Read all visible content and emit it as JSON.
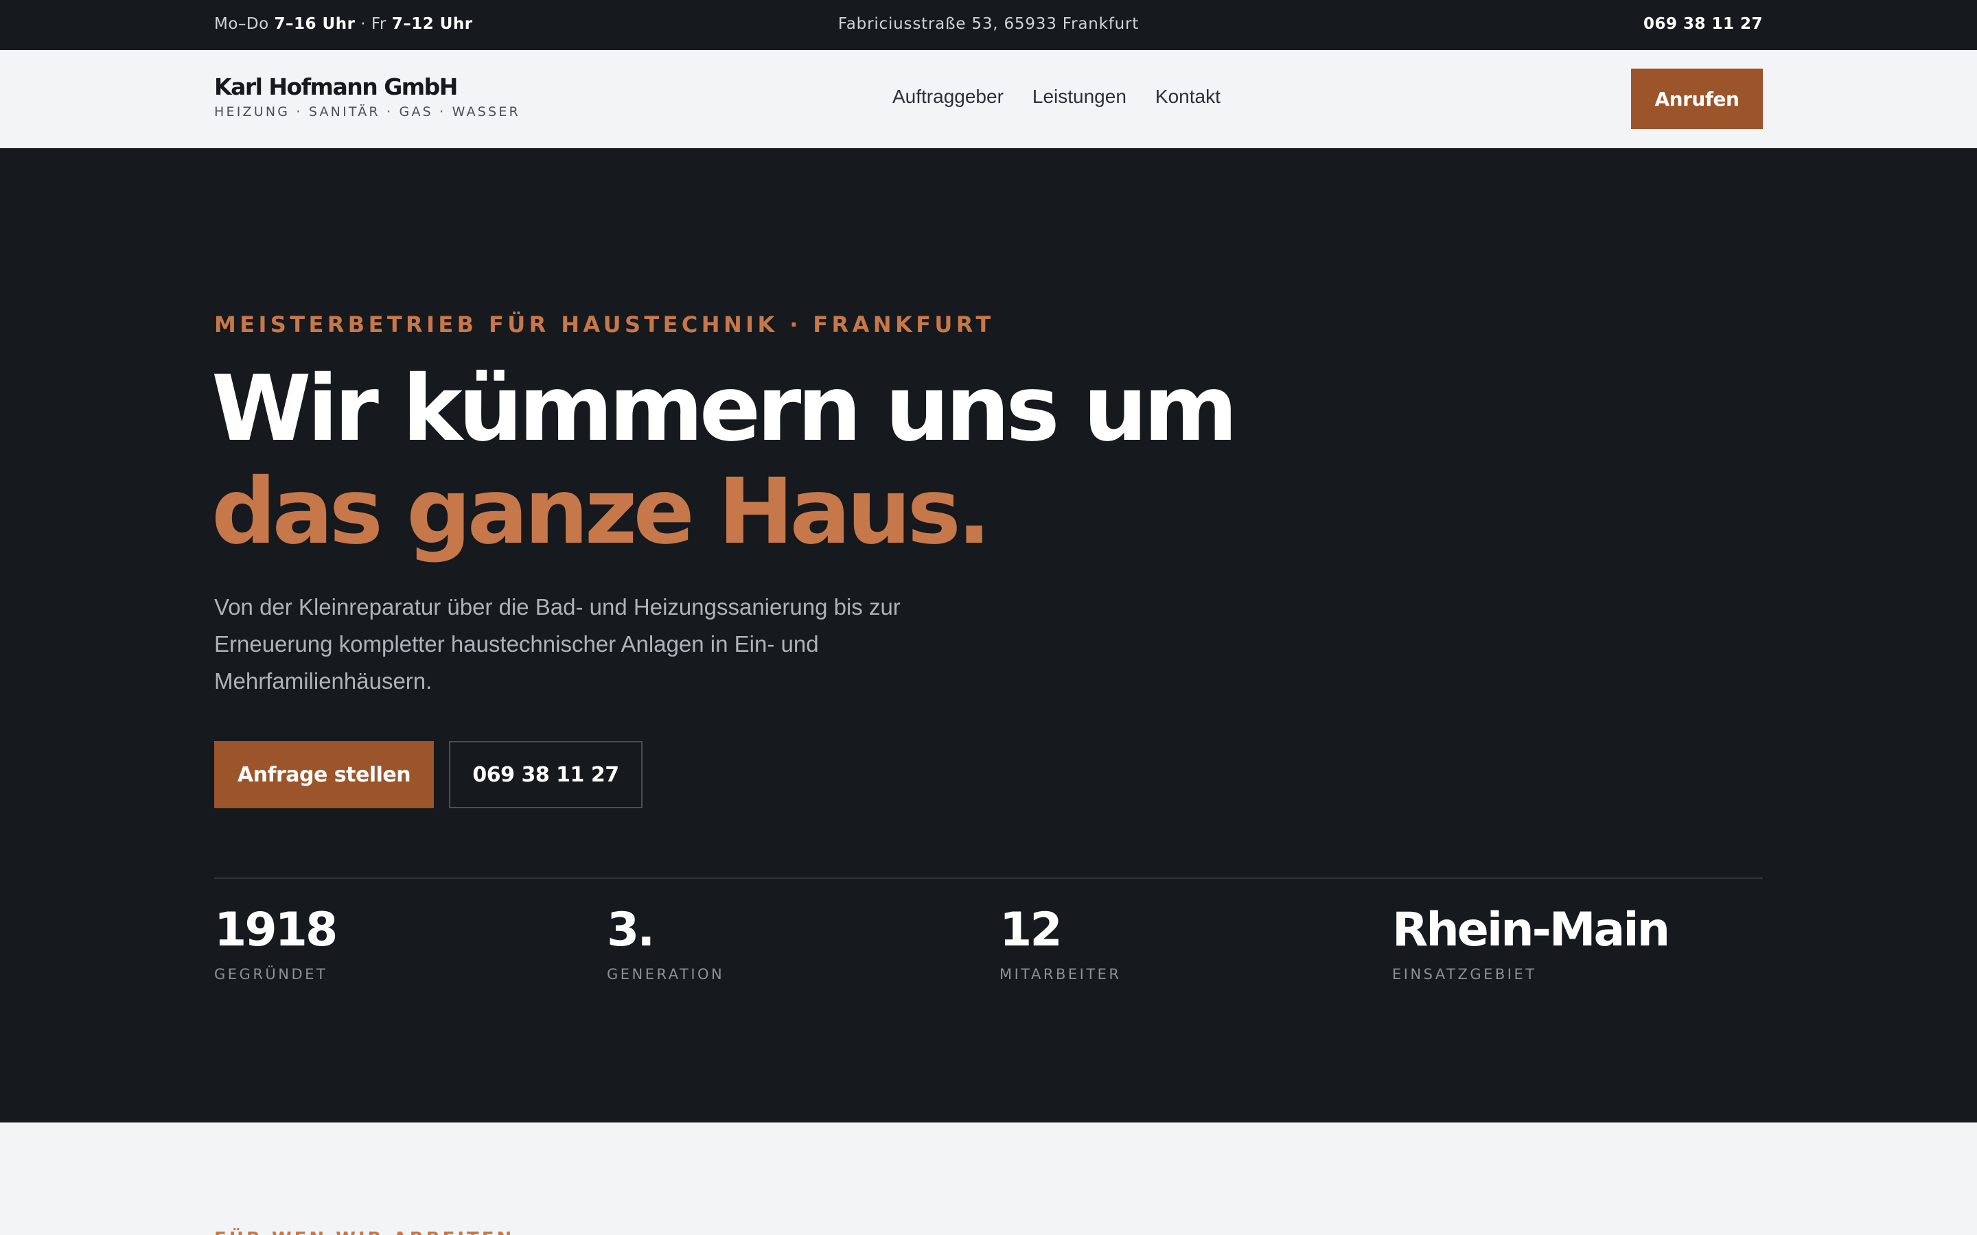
{
  "topbar": {
    "hours_prefix1": "Mo–Do ",
    "hours_value1": "7–16 Uhr",
    "hours_sep": " · Fr ",
    "hours_value2": "7–12 Uhr",
    "address": "Fabriciusstraße 53, 65933 Frankfurt",
    "phone": "069 38 11 27"
  },
  "header": {
    "brand_name": "Karl Hofmann GmbH",
    "brand_tagline": "HEIZUNG · SANITÄR · GAS · WASSER",
    "nav": [
      {
        "label": "Auftraggeber"
      },
      {
        "label": "Leistungen"
      },
      {
        "label": "Kontakt"
      }
    ],
    "call_label": "Anrufen"
  },
  "hero": {
    "eyebrow": "MEISTERBETRIEB FÜR HAUSTECHNIK · FRANKFURT",
    "headline_line1": "Wir kümmern uns um",
    "headline_line2": "das ganze Haus.",
    "lede": "Von der Kleinreparatur über die Bad- und Heizungssanierung bis zur Erneuerung kompletter haustechnischer Anlagen in Ein- und Mehrfamilienhäusern.",
    "primary_cta": "Anfrage stellen",
    "secondary_cta": "069 38 11 27",
    "stats": [
      {
        "value": "1918",
        "label": "GEGRÜNDET"
      },
      {
        "value": "3.",
        "label": "GENERATION"
      },
      {
        "value": "12",
        "label": "MITARBEITER"
      },
      {
        "value": "Rhein-Main",
        "label": "EINSATZGEBIET"
      }
    ]
  },
  "next_section": {
    "eyebrow": "FÜR WEN WIR ARBEITEN"
  },
  "colors": {
    "dark": "#16191d",
    "accent": "#c6784a",
    "button": "#9c542a",
    "light": "#f3f4f6"
  }
}
